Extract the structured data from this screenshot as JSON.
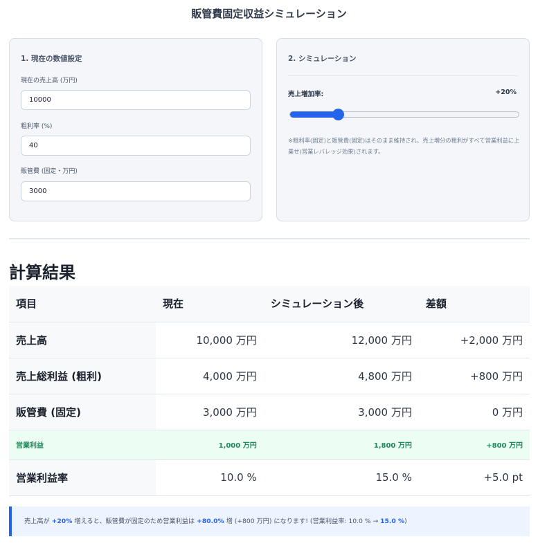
{
  "page": {
    "title": "販管費固定収益シミュレーション"
  },
  "settings": {
    "heading": "1. 現在の数値設定",
    "sales_label": "現在の売上高 (万円)",
    "sales_value": "10000",
    "margin_label": "粗利率 (%)",
    "margin_value": "40",
    "sga_label": "販管費 (固定・万円)",
    "sga_value": "3000"
  },
  "simulation": {
    "heading": "2. シミュレーション",
    "slider_label": "売上増加率:",
    "slider_value_text": "+20%",
    "slider_fraction": 0.21,
    "note": "※粗利率(固定)と販管費(固定)はそのまま維持され、売上増分の粗利がすべて営業利益に上乗せ(営業レバレッジ効果)されます。"
  },
  "results": {
    "title": "計算結果",
    "headers": [
      "項目",
      "現在",
      "シミュレーション後",
      "差額"
    ],
    "rows": [
      [
        "売上高",
        "10,000 万円",
        "12,000 万円",
        "+2,000 万円"
      ],
      [
        "売上総利益 (粗利)",
        "4,000 万円",
        "4,800 万円",
        "+800 万円"
      ],
      [
        "販管費 (固定)",
        "3,000 万円",
        "3,000 万円",
        "0 万円"
      ],
      [
        "営業利益",
        "1,000 万円",
        "1,800 万円",
        "+800 万円"
      ],
      [
        "営業利益率",
        "10.0 %",
        "15.0 %",
        "+5.0 pt"
      ]
    ]
  },
  "summary": {
    "p1": "売上高が ",
    "h1": "+20%",
    "p2": " 増えると、販管費が固定のため営業利益は ",
    "h2": "+80.0%",
    "p3": " 増 (+800 万円) になります! (営業利益率: 10.0 % → ",
    "h3": "15.0 %",
    "p4": ")"
  },
  "colors": {
    "accent": "#2563eb",
    "profit_bg": "#ecfdf3",
    "profit_text": "#1f8a5b"
  }
}
